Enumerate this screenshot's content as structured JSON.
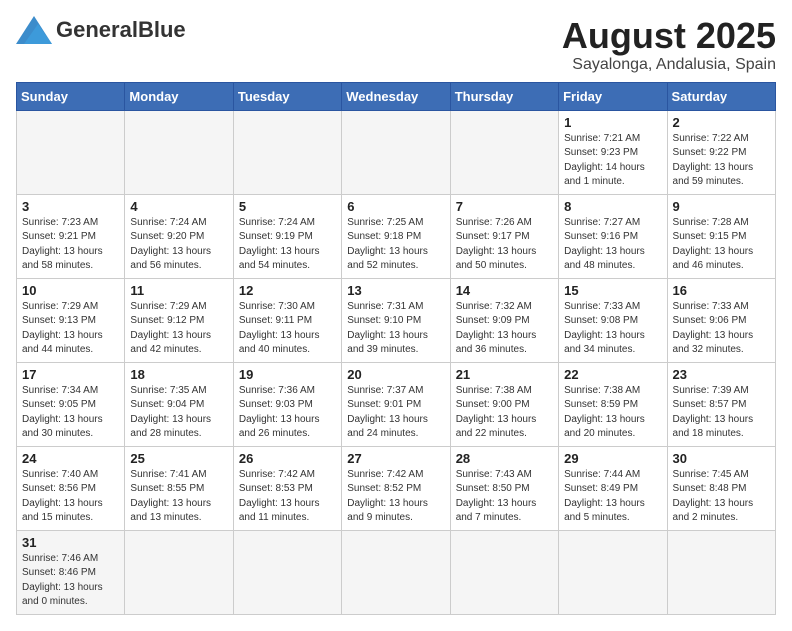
{
  "header": {
    "logo_text_normal": "General",
    "logo_text_bold": "Blue",
    "month_title": "August 2025",
    "location": "Sayalonga, Andalusia, Spain"
  },
  "weekdays": [
    "Sunday",
    "Monday",
    "Tuesday",
    "Wednesday",
    "Thursday",
    "Friday",
    "Saturday"
  ],
  "days": [
    {
      "date": null,
      "empty": true
    },
    {
      "date": null,
      "empty": true
    },
    {
      "date": null,
      "empty": true
    },
    {
      "date": null,
      "empty": true
    },
    {
      "date": null,
      "empty": true
    },
    {
      "date": "1",
      "info": "Sunrise: 7:21 AM\nSunset: 9:23 PM\nDaylight: 14 hours\nand 1 minute."
    },
    {
      "date": "2",
      "info": "Sunrise: 7:22 AM\nSunset: 9:22 PM\nDaylight: 13 hours\nand 59 minutes."
    },
    {
      "date": "3",
      "info": "Sunrise: 7:23 AM\nSunset: 9:21 PM\nDaylight: 13 hours\nand 58 minutes."
    },
    {
      "date": "4",
      "info": "Sunrise: 7:24 AM\nSunset: 9:20 PM\nDaylight: 13 hours\nand 56 minutes."
    },
    {
      "date": "5",
      "info": "Sunrise: 7:24 AM\nSunset: 9:19 PM\nDaylight: 13 hours\nand 54 minutes."
    },
    {
      "date": "6",
      "info": "Sunrise: 7:25 AM\nSunset: 9:18 PM\nDaylight: 13 hours\nand 52 minutes."
    },
    {
      "date": "7",
      "info": "Sunrise: 7:26 AM\nSunset: 9:17 PM\nDaylight: 13 hours\nand 50 minutes."
    },
    {
      "date": "8",
      "info": "Sunrise: 7:27 AM\nSunset: 9:16 PM\nDaylight: 13 hours\nand 48 minutes."
    },
    {
      "date": "9",
      "info": "Sunrise: 7:28 AM\nSunset: 9:15 PM\nDaylight: 13 hours\nand 46 minutes."
    },
    {
      "date": "10",
      "info": "Sunrise: 7:29 AM\nSunset: 9:13 PM\nDaylight: 13 hours\nand 44 minutes."
    },
    {
      "date": "11",
      "info": "Sunrise: 7:29 AM\nSunset: 9:12 PM\nDaylight: 13 hours\nand 42 minutes."
    },
    {
      "date": "12",
      "info": "Sunrise: 7:30 AM\nSunset: 9:11 PM\nDaylight: 13 hours\nand 40 minutes."
    },
    {
      "date": "13",
      "info": "Sunrise: 7:31 AM\nSunset: 9:10 PM\nDaylight: 13 hours\nand 39 minutes."
    },
    {
      "date": "14",
      "info": "Sunrise: 7:32 AM\nSunset: 9:09 PM\nDaylight: 13 hours\nand 36 minutes."
    },
    {
      "date": "15",
      "info": "Sunrise: 7:33 AM\nSunset: 9:08 PM\nDaylight: 13 hours\nand 34 minutes."
    },
    {
      "date": "16",
      "info": "Sunrise: 7:33 AM\nSunset: 9:06 PM\nDaylight: 13 hours\nand 32 minutes."
    },
    {
      "date": "17",
      "info": "Sunrise: 7:34 AM\nSunset: 9:05 PM\nDaylight: 13 hours\nand 30 minutes."
    },
    {
      "date": "18",
      "info": "Sunrise: 7:35 AM\nSunset: 9:04 PM\nDaylight: 13 hours\nand 28 minutes."
    },
    {
      "date": "19",
      "info": "Sunrise: 7:36 AM\nSunset: 9:03 PM\nDaylight: 13 hours\nand 26 minutes."
    },
    {
      "date": "20",
      "info": "Sunrise: 7:37 AM\nSunset: 9:01 PM\nDaylight: 13 hours\nand 24 minutes."
    },
    {
      "date": "21",
      "info": "Sunrise: 7:38 AM\nSunset: 9:00 PM\nDaylight: 13 hours\nand 22 minutes."
    },
    {
      "date": "22",
      "info": "Sunrise: 7:38 AM\nSunset: 8:59 PM\nDaylight: 13 hours\nand 20 minutes."
    },
    {
      "date": "23",
      "info": "Sunrise: 7:39 AM\nSunset: 8:57 PM\nDaylight: 13 hours\nand 18 minutes."
    },
    {
      "date": "24",
      "info": "Sunrise: 7:40 AM\nSunset: 8:56 PM\nDaylight: 13 hours\nand 15 minutes."
    },
    {
      "date": "25",
      "info": "Sunrise: 7:41 AM\nSunset: 8:55 PM\nDaylight: 13 hours\nand 13 minutes."
    },
    {
      "date": "26",
      "info": "Sunrise: 7:42 AM\nSunset: 8:53 PM\nDaylight: 13 hours\nand 11 minutes."
    },
    {
      "date": "27",
      "info": "Sunrise: 7:42 AM\nSunset: 8:52 PM\nDaylight: 13 hours\nand 9 minutes."
    },
    {
      "date": "28",
      "info": "Sunrise: 7:43 AM\nSunset: 8:50 PM\nDaylight: 13 hours\nand 7 minutes."
    },
    {
      "date": "29",
      "info": "Sunrise: 7:44 AM\nSunset: 8:49 PM\nDaylight: 13 hours\nand 5 minutes."
    },
    {
      "date": "30",
      "info": "Sunrise: 7:45 AM\nSunset: 8:48 PM\nDaylight: 13 hours\nand 2 minutes."
    },
    {
      "date": "31",
      "info": "Sunrise: 7:46 AM\nSunset: 8:46 PM\nDaylight: 13 hours\nand 0 minutes.",
      "last_row": true
    },
    {
      "date": null,
      "empty": true,
      "last_row": true
    },
    {
      "date": null,
      "empty": true,
      "last_row": true
    },
    {
      "date": null,
      "empty": true,
      "last_row": true
    },
    {
      "date": null,
      "empty": true,
      "last_row": true
    },
    {
      "date": null,
      "empty": true,
      "last_row": true
    },
    {
      "date": null,
      "empty": true,
      "last_row": true
    }
  ]
}
